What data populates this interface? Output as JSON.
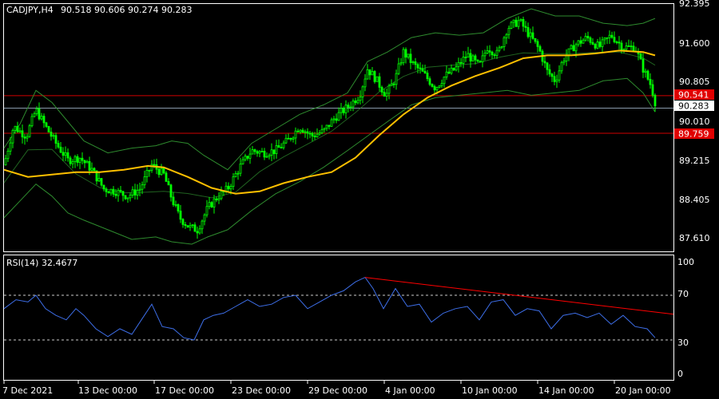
{
  "main_chart": {
    "symbol_label": "CADJPY,H4",
    "ohlc_label": "90.518 90.606 90.274 90.283",
    "y_ticks": [
      "92.395",
      "91.600",
      "90.805",
      "90.010",
      "89.215",
      "88.405",
      "87.610"
    ],
    "price_tags": [
      {
        "text": "90.541",
        "color": "#e00000"
      },
      {
        "text": "90.283",
        "color": "#ffffff"
      },
      {
        "text": "89.759",
        "color": "#e00000"
      }
    ]
  },
  "rsi_panel": {
    "label": "RSI(14) 32.4677",
    "y_ticks": [
      "100",
      "70",
      "30",
      "0"
    ]
  },
  "x_axis": {
    "ticks": [
      "7 Dec 2021",
      "13 Dec 00:00",
      "17 Dec 00:00",
      "23 Dec 00:00",
      "29 Dec 00:00",
      "4 Jan 00:00",
      "10 Jan 00:00",
      "14 Jan 00:00",
      "20 Jan 00:00"
    ]
  },
  "colors": {
    "background": "#000000",
    "grid_border": "#ffffff",
    "candles": "#00ff00",
    "bollinger": "#2e8b2e",
    "moving_average": "#ffc000",
    "rsi_line": "#3d6ee8",
    "trendline": "#ff0000",
    "hline": "#d00000",
    "price_line": "#8899aa"
  },
  "chart_data": {
    "type": "candlestick",
    "symbol": "CADJPY",
    "timeframe": "H4",
    "ohlc": {
      "open": 90.518,
      "high": 90.606,
      "low": 90.274,
      "close": 90.283
    },
    "close_path": [
      [
        0,
        89.1
      ],
      [
        12,
        89.9
      ],
      [
        28,
        89.7
      ],
      [
        40,
        90.25
      ],
      [
        52,
        89.9
      ],
      [
        65,
        89.55
      ],
      [
        80,
        89.2
      ],
      [
        95,
        89.25
      ],
      [
        110,
        89.0
      ],
      [
        125,
        88.6
      ],
      [
        140,
        88.55
      ],
      [
        155,
        88.45
      ],
      [
        170,
        88.6
      ],
      [
        185,
        89.1
      ],
      [
        200,
        88.9
      ],
      [
        210,
        88.4
      ],
      [
        220,
        88.0
      ],
      [
        232,
        87.8
      ],
      [
        242,
        87.75
      ],
      [
        255,
        88.2
      ],
      [
        268,
        88.45
      ],
      [
        280,
        88.6
      ],
      [
        295,
        89.05
      ],
      [
        310,
        89.4
      ],
      [
        325,
        89.35
      ],
      [
        340,
        89.4
      ],
      [
        355,
        89.6
      ],
      [
        370,
        89.9
      ],
      [
        385,
        89.7
      ],
      [
        400,
        89.8
      ],
      [
        415,
        90.1
      ],
      [
        430,
        90.3
      ],
      [
        445,
        90.55
      ],
      [
        455,
        91.1
      ],
      [
        465,
        90.9
      ],
      [
        478,
        90.55
      ],
      [
        490,
        90.9
      ],
      [
        500,
        91.45
      ],
      [
        512,
        91.2
      ],
      [
        525,
        91.0
      ],
      [
        540,
        90.7
      ],
      [
        552,
        90.95
      ],
      [
        565,
        91.1
      ],
      [
        580,
        91.4
      ],
      [
        595,
        91.15
      ],
      [
        605,
        91.55
      ],
      [
        618,
        91.4
      ],
      [
        630,
        91.95
      ],
      [
        645,
        92.1
      ],
      [
        660,
        91.75
      ],
      [
        670,
        91.5
      ],
      [
        680,
        91.05
      ],
      [
        690,
        90.85
      ],
      [
        700,
        91.3
      ],
      [
        715,
        91.6
      ],
      [
        730,
        91.75
      ],
      [
        745,
        91.55
      ],
      [
        760,
        91.8
      ],
      [
        775,
        91.55
      ],
      [
        790,
        91.55
      ],
      [
        800,
        91.1
      ],
      [
        810,
        90.75
      ],
      [
        817,
        90.28
      ]
    ],
    "moving_average_path": [
      [
        0,
        89.0
      ],
      [
        30,
        88.85
      ],
      [
        60,
        88.9
      ],
      [
        90,
        88.95
      ],
      [
        120,
        88.95
      ],
      [
        150,
        89.0
      ],
      [
        180,
        89.08
      ],
      [
        200,
        89.05
      ],
      [
        230,
        88.85
      ],
      [
        260,
        88.62
      ],
      [
        290,
        88.5
      ],
      [
        320,
        88.55
      ],
      [
        350,
        88.72
      ],
      [
        380,
        88.85
      ],
      [
        410,
        88.95
      ],
      [
        440,
        89.25
      ],
      [
        470,
        89.72
      ],
      [
        500,
        90.15
      ],
      [
        530,
        90.5
      ],
      [
        560,
        90.75
      ],
      [
        590,
        90.95
      ],
      [
        620,
        91.12
      ],
      [
        650,
        91.32
      ],
      [
        680,
        91.38
      ],
      [
        710,
        91.38
      ],
      [
        740,
        91.42
      ],
      [
        770,
        91.48
      ],
      [
        800,
        91.45
      ],
      [
        815,
        91.38
      ]
    ],
    "bollinger_upper_path": [
      [
        0,
        89.45
      ],
      [
        20,
        89.95
      ],
      [
        40,
        90.65
      ],
      [
        60,
        90.4
      ],
      [
        80,
        90.0
      ],
      [
        100,
        89.6
      ],
      [
        130,
        89.35
      ],
      [
        160,
        89.45
      ],
      [
        190,
        89.5
      ],
      [
        210,
        89.6
      ],
      [
        230,
        89.55
      ],
      [
        250,
        89.3
      ],
      [
        280,
        89.0
      ],
      [
        310,
        89.55
      ],
      [
        340,
        89.85
      ],
      [
        370,
        90.15
      ],
      [
        400,
        90.35
      ],
      [
        430,
        90.6
      ],
      [
        455,
        91.25
      ],
      [
        480,
        91.45
      ],
      [
        510,
        91.75
      ],
      [
        540,
        91.85
      ],
      [
        570,
        91.8
      ],
      [
        600,
        91.85
      ],
      [
        630,
        92.15
      ],
      [
        660,
        92.35
      ],
      [
        690,
        92.2
      ],
      [
        720,
        92.2
      ],
      [
        750,
        92.05
      ],
      [
        780,
        92.0
      ],
      [
        800,
        92.05
      ],
      [
        815,
        92.15
      ]
    ],
    "bollinger_lower_path": [
      [
        0,
        88.0
      ],
      [
        20,
        88.35
      ],
      [
        40,
        88.7
      ],
      [
        60,
        88.45
      ],
      [
        80,
        88.1
      ],
      [
        100,
        87.95
      ],
      [
        130,
        87.75
      ],
      [
        160,
        87.55
      ],
      [
        190,
        87.6
      ],
      [
        210,
        87.5
      ],
      [
        235,
        87.45
      ],
      [
        255,
        87.6
      ],
      [
        280,
        87.75
      ],
      [
        310,
        88.15
      ],
      [
        340,
        88.5
      ],
      [
        370,
        88.75
      ],
      [
        400,
        89.05
      ],
      [
        430,
        89.4
      ],
      [
        455,
        89.7
      ],
      [
        480,
        90.0
      ],
      [
        510,
        90.35
      ],
      [
        540,
        90.5
      ],
      [
        570,
        90.55
      ],
      [
        600,
        90.6
      ],
      [
        630,
        90.65
      ],
      [
        660,
        90.55
      ],
      [
        690,
        90.6
      ],
      [
        720,
        90.65
      ],
      [
        750,
        90.85
      ],
      [
        780,
        90.9
      ],
      [
        800,
        90.6
      ],
      [
        815,
        90.2
      ]
    ],
    "horizontal_levels": [
      90.541,
      89.759
    ],
    "current_price": 90.283,
    "ylim": [
      87.3,
      92.45
    ],
    "rsi": {
      "period": 14,
      "value": 32.4677,
      "levels": [
        70,
        30
      ],
      "ylim": [
        0,
        100
      ],
      "path": [
        [
          0,
          58
        ],
        [
          15,
          66
        ],
        [
          30,
          64
        ],
        [
          40,
          70
        ],
        [
          52,
          58
        ],
        [
          65,
          52
        ],
        [
          78,
          48
        ],
        [
          90,
          58
        ],
        [
          100,
          52
        ],
        [
          115,
          40
        ],
        [
          130,
          33
        ],
        [
          145,
          40
        ],
        [
          160,
          35
        ],
        [
          172,
          48
        ],
        [
          185,
          62
        ],
        [
          198,
          42
        ],
        [
          212,
          40
        ],
        [
          225,
          32
        ],
        [
          238,
          30
        ],
        [
          250,
          48
        ],
        [
          262,
          52
        ],
        [
          275,
          54
        ],
        [
          290,
          60
        ],
        [
          305,
          66
        ],
        [
          320,
          60
        ],
        [
          335,
          62
        ],
        [
          350,
          68
        ],
        [
          365,
          70
        ],
        [
          380,
          58
        ],
        [
          395,
          64
        ],
        [
          410,
          70
        ],
        [
          425,
          74
        ],
        [
          440,
          82
        ],
        [
          452,
          86
        ],
        [
          462,
          76
        ],
        [
          475,
          58
        ],
        [
          490,
          76
        ],
        [
          505,
          60
        ],
        [
          520,
          62
        ],
        [
          535,
          46
        ],
        [
          550,
          54
        ],
        [
          565,
          58
        ],
        [
          580,
          60
        ],
        [
          595,
          48
        ],
        [
          610,
          64
        ],
        [
          625,
          66
        ],
        [
          640,
          52
        ],
        [
          655,
          58
        ],
        [
          670,
          56
        ],
        [
          685,
          40
        ],
        [
          700,
          52
        ],
        [
          715,
          54
        ],
        [
          730,
          50
        ],
        [
          745,
          54
        ],
        [
          760,
          44
        ],
        [
          775,
          52
        ],
        [
          790,
          42
        ],
        [
          805,
          40
        ],
        [
          815,
          32
        ]
      ],
      "trendline": [
        [
          452,
          86
        ],
        [
          845,
          53
        ]
      ]
    }
  }
}
